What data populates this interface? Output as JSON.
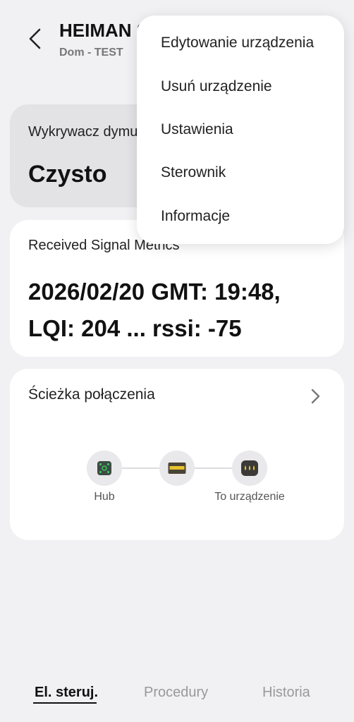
{
  "header": {
    "title": "HEIMAN Smok",
    "subtitle": "Dom - TEST"
  },
  "status_card": {
    "label": "Wykrywacz dymu",
    "value": "Czysto"
  },
  "signal_card": {
    "label": "Received Signal Metrics",
    "value": "2026/02/20 GMT: 19:48, LQI: 204 ... rssi: -75"
  },
  "path_card": {
    "title": "Ścieżka połączenia",
    "nodes": [
      {
        "label": "Hub",
        "icon": "hub-icon"
      },
      {
        "label": "",
        "icon": "router-icon"
      },
      {
        "label": "To urządzenie",
        "icon": "device-icon"
      }
    ]
  },
  "menu": {
    "items": [
      "Edytowanie urządzenia",
      "Usuń urządzenie",
      "Ustawienia",
      "Sterownik",
      "Informacje"
    ]
  },
  "tabs": [
    "El. steruj.",
    "Procedury",
    "Historia"
  ],
  "colors": {
    "background": "#f1f0f2",
    "card": "#ffffff",
    "status_card": "#e3e2e5",
    "hub_green": "#3cc35a",
    "router_yellow": "#e8c22e"
  }
}
